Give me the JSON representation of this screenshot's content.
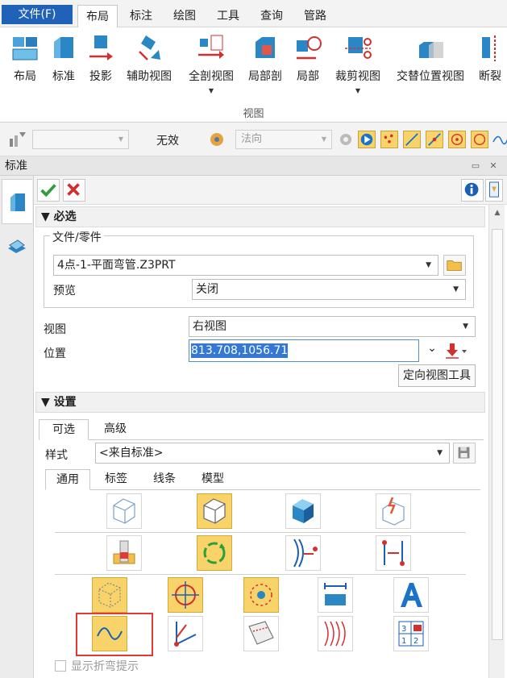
{
  "menu": {
    "file": "文件(F)",
    "tabs": [
      "布局",
      "标注",
      "绘图",
      "工具",
      "查询",
      "管路"
    ]
  },
  "ribbon": {
    "buttons": [
      "布局",
      "标准",
      "投影",
      "辅助视图",
      "全剖视图",
      "局部剖",
      "局部",
      "裁剪视图",
      "交替位置视图",
      "断裂"
    ],
    "group_label": "视图"
  },
  "toolbar": {
    "status_text": "无效",
    "direction_placeholder": "法向"
  },
  "panel": {
    "title": "标准",
    "required_section": "必选",
    "file_part_legend": "文件/零件",
    "file_value": "4点-1-平面弯管.Z3PRT",
    "preview_label": "预览",
    "preview_value": "关闭",
    "view_label": "视图",
    "view_value": "右视图",
    "position_label": "位置",
    "position_value": "813.708,1056.71",
    "orient_tool_button": "定向视图工具",
    "settings_section": "设置",
    "settings_tabs": [
      "可选",
      "高级"
    ],
    "style_label": "样式",
    "style_value": "<来自标准>",
    "sub_tabs": [
      "通用",
      "标签",
      "线条",
      "模型"
    ],
    "show_bend_hint": "显示折弯提示"
  },
  "colors": {
    "accent": "#1f62b8",
    "selected_icon": "#f7d36a",
    "highlight_box": "#e53935"
  }
}
